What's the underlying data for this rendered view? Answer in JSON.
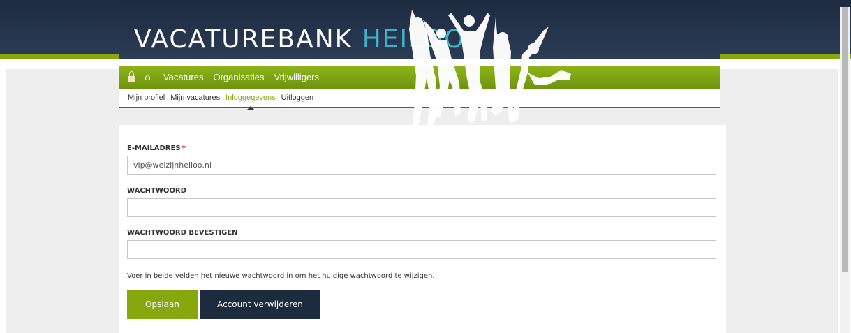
{
  "site": {
    "logo_word1": "VACATUREBANK",
    "logo_word2": "HEILOO",
    "accent_green": "#86a80e",
    "navy": "#1d2b3f",
    "logo_cyan": "#3fb1c8"
  },
  "mainnav": {
    "icons": [
      "lock-icon",
      "home-icon"
    ],
    "items": [
      {
        "label": "Vacatures"
      },
      {
        "label": "Organisaties"
      },
      {
        "label": "Vrijwilligers"
      }
    ]
  },
  "subnav": {
    "items": [
      {
        "label": "Mijn profiel"
      },
      {
        "label": "Mijn vacatures"
      },
      {
        "label": "Inloggegevens",
        "active": true
      },
      {
        "label": "Uitloggen"
      }
    ]
  },
  "form": {
    "email": {
      "label": "E-MAILADRES",
      "required_marker": "*",
      "value": "vip@welzijnheiloo.nl"
    },
    "password": {
      "label": "WACHTWOORD",
      "value": ""
    },
    "password_confirm": {
      "label": "WACHTWOORD BEVESTIGEN",
      "value": ""
    },
    "hint": "Voer in beide velden het nieuwe wachtwoord in om het huidige wachtwoord te wijzigen.",
    "save_button": "Opslaan",
    "delete_button": "Account verwijderen"
  }
}
